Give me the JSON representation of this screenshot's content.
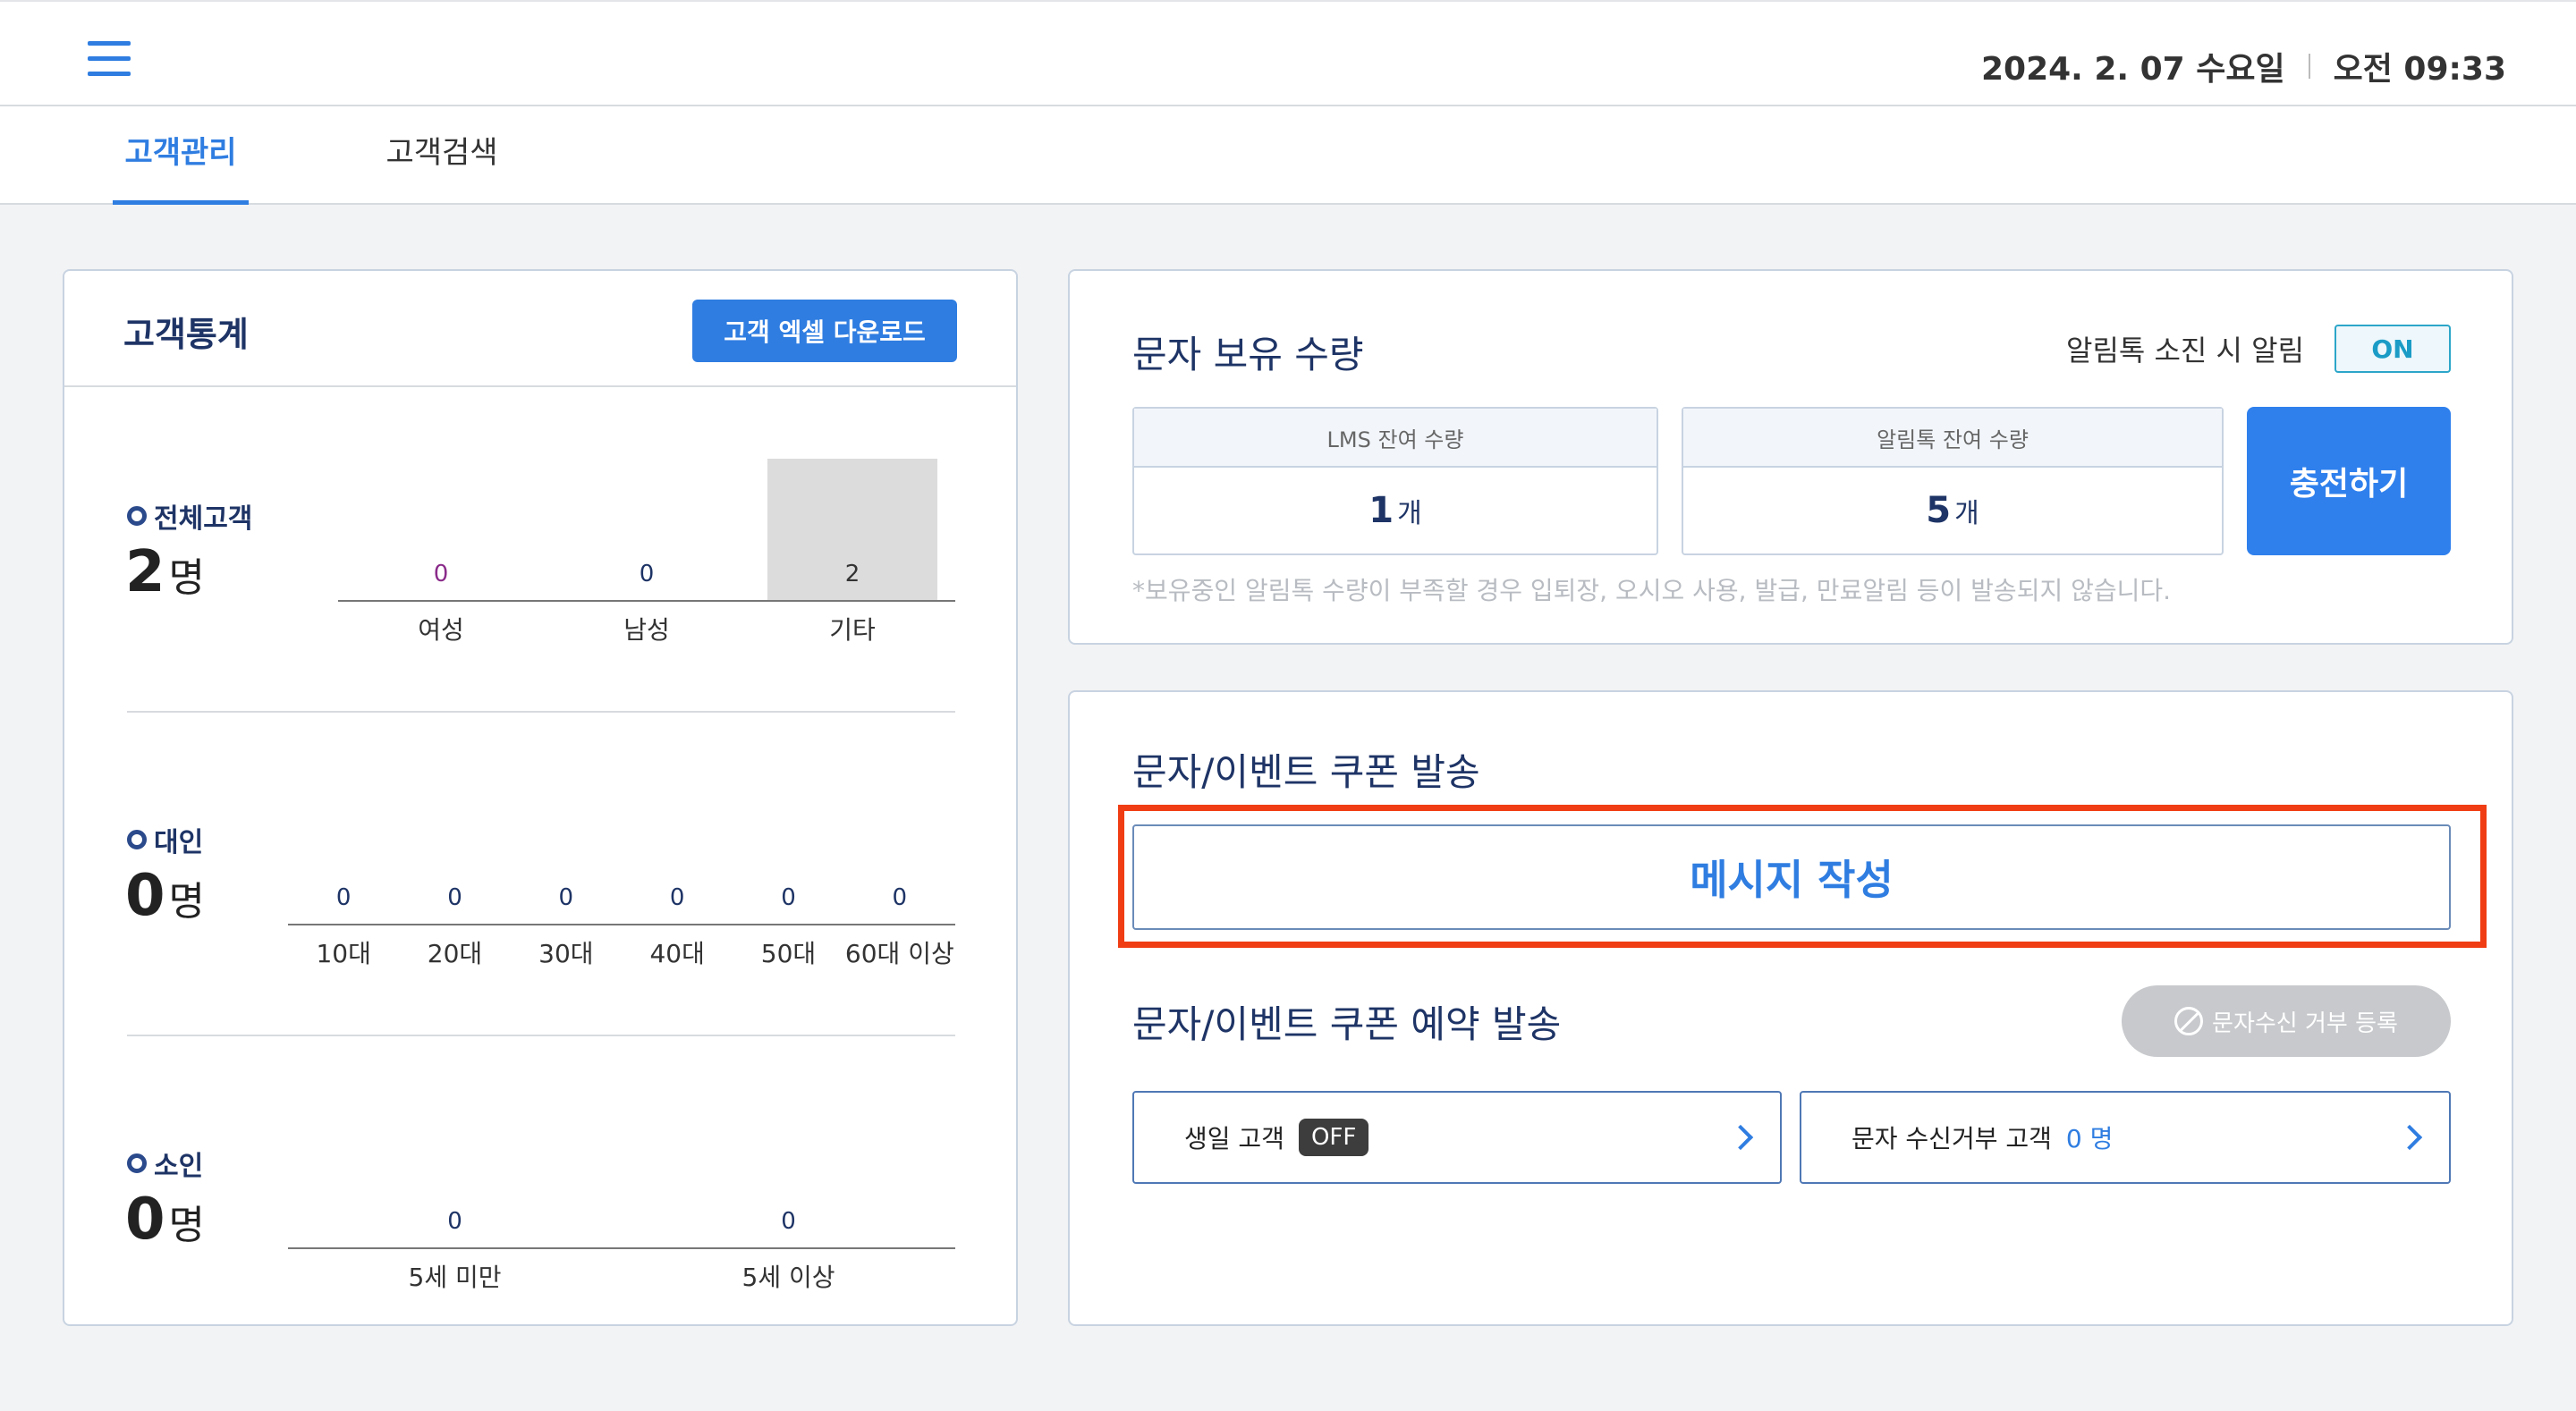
{
  "header": {
    "date": "2024. 2. 07 수요일",
    "time": "오전 09:33"
  },
  "tabs": [
    {
      "label": "고객관리",
      "active": true
    },
    {
      "label": "고객검색",
      "active": false
    }
  ],
  "stats": {
    "title": "고객통계",
    "download_label": "고객 엑셀 다운로드",
    "unit": "명",
    "total": {
      "label": "전체고객",
      "count": "2",
      "categories": [
        "여성",
        "남성",
        "기타"
      ],
      "values": [
        0,
        0,
        2
      ],
      "value_labels": [
        "0",
        "0",
        "2"
      ],
      "value_colors": [
        "#8a2b8a",
        "#1e3466",
        "#333333"
      ]
    },
    "adult": {
      "label": "대인",
      "count": "0",
      "categories": [
        "10대",
        "20대",
        "30대",
        "40대",
        "50대",
        "60대 이상"
      ],
      "values": [
        0,
        0,
        0,
        0,
        0,
        0
      ],
      "value_labels": [
        "0",
        "0",
        "0",
        "0",
        "0",
        "0"
      ]
    },
    "child": {
      "label": "소인",
      "count": "0",
      "categories": [
        "5세 미만",
        "5세 이상"
      ],
      "values": [
        0,
        0
      ],
      "value_labels": [
        "0",
        "0"
      ]
    }
  },
  "sms_balance": {
    "title": "문자 보유 수량",
    "alert_label": "알림톡 소진 시 알림",
    "alert_toggle": "ON",
    "lms_label": "LMS 잔여 수량",
    "lms_count": "1",
    "alimtalk_label": "알림톡 잔여 수량",
    "alimtalk_count": "5",
    "count_unit": "개",
    "charge_label": "충전하기",
    "notice": "*보유중인 알림톡 수량이 부족할 경우 입퇴장, 오시오 사용, 발급, 만료알림 등이 발송되지 않습니다."
  },
  "coupon": {
    "send_title": "문자/이벤트 쿠폰 발송",
    "compose_label": "메시지 작성",
    "reserve_title": "문자/이벤트 쿠폰 예약 발송",
    "reject_register_label": "문자수신 거부 등록",
    "birthday_label": "생일 고객",
    "birthday_toggle": "OFF",
    "rejected_label": "문자 수신거부 고객",
    "rejected_count": "0 명"
  },
  "colors": {
    "accent": "#2f7de1",
    "highlight": "#f03d13",
    "navy": "#1e3466"
  }
}
